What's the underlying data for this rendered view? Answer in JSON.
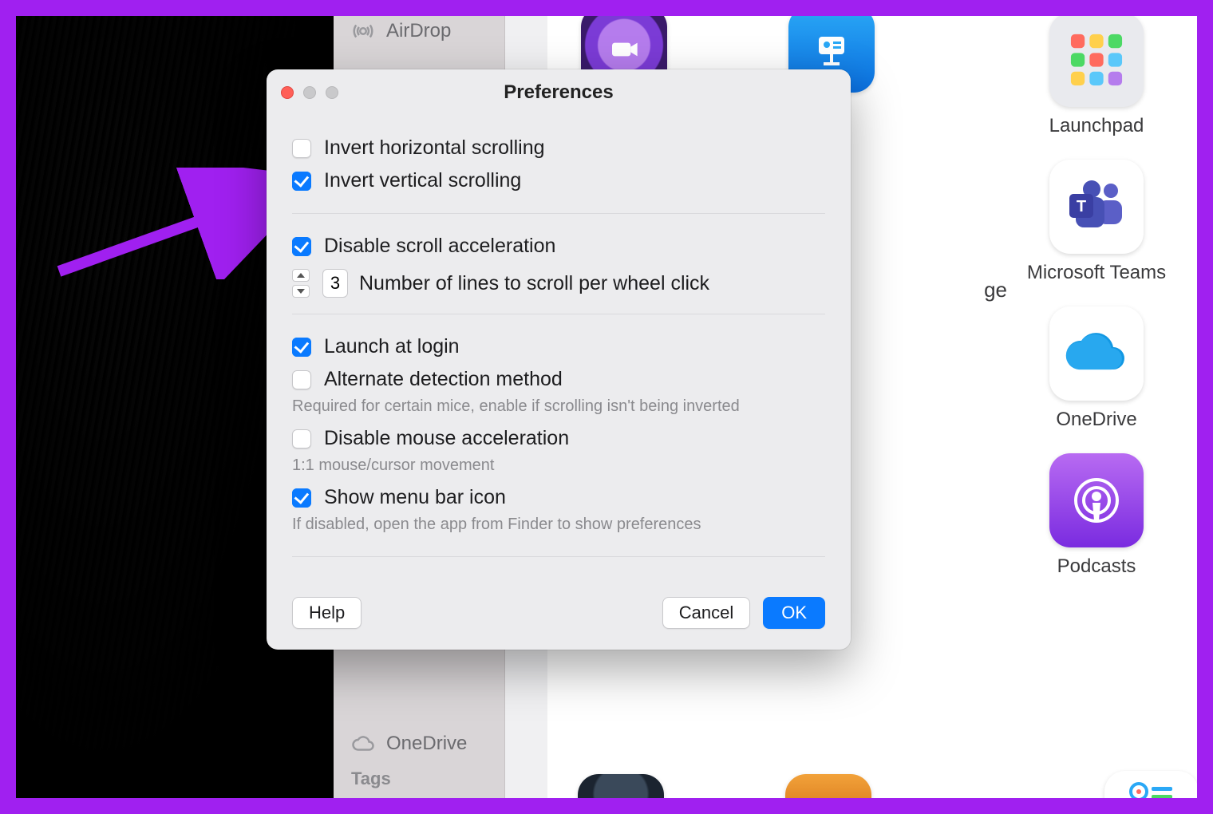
{
  "finder": {
    "airdrop": "AirDrop",
    "onedrive": "OneDrive",
    "tags": "Tags"
  },
  "bg_text_fragment": "ge",
  "apps": {
    "launchpad": "Launchpad",
    "teams": "Microsoft Teams",
    "onedrive": "OneDrive",
    "podcasts": "Podcasts"
  },
  "prefs": {
    "title": "Preferences",
    "group1": {
      "opt1": "Invert horizontal scrolling",
      "opt2": "Invert vertical scrolling"
    },
    "group2": {
      "opt1": "Disable scroll acceleration",
      "lines_value": "3",
      "lines_label": "Number of lines to scroll per wheel click"
    },
    "group3": {
      "opt1": "Launch at login",
      "opt2": "Alternate detection method",
      "hint2": "Required for certain mice, enable if scrolling isn't being inverted",
      "opt3": "Disable mouse acceleration",
      "hint3": "1:1 mouse/cursor movement",
      "opt4": "Show menu bar icon",
      "hint4": "If disabled, open the app from Finder to show preferences"
    },
    "buttons": {
      "help": "Help",
      "cancel": "Cancel",
      "ok": "OK"
    }
  }
}
